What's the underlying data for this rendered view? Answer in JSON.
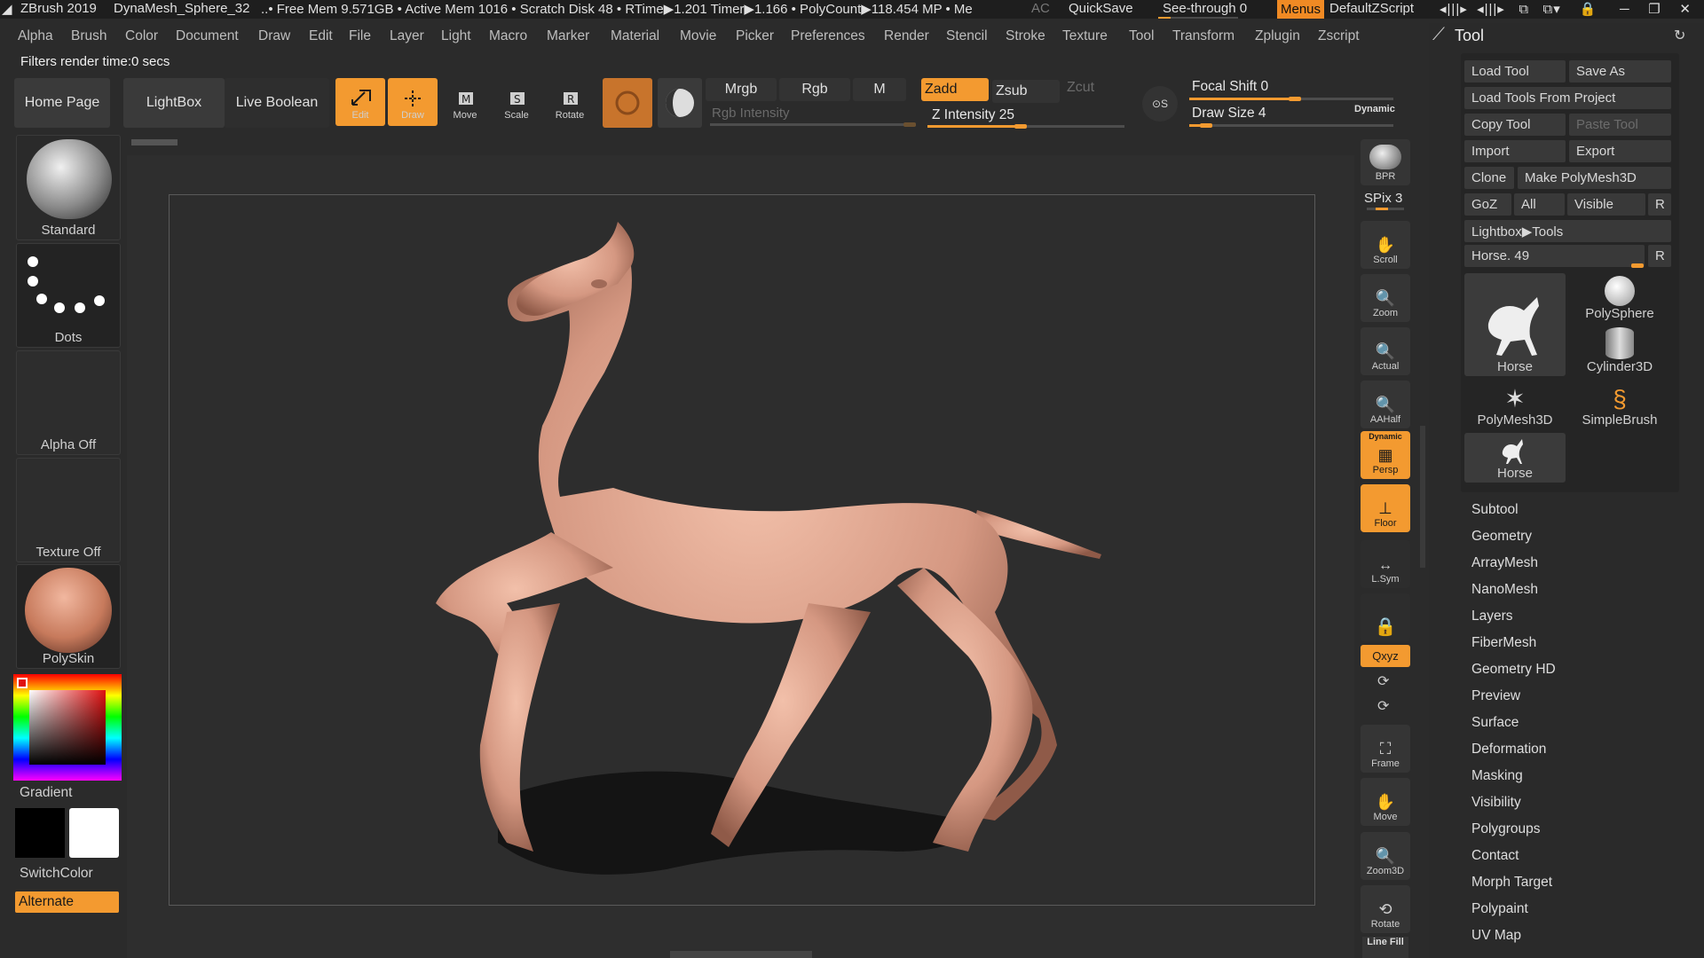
{
  "titlebar": {
    "app": "ZBrush 2019",
    "doc": "DynaMesh_Sphere_32",
    "stats": "..• Free Mem 9.571GB • Active Mem 1016 • Scratch Disk 48 • RTime▶1.201 Timer▶1.166 • PolyCount▶118.454 MP • Me",
    "ac": "AC",
    "quicksave": "QuickSave",
    "see_through": "See-through  0",
    "menus": "Menus",
    "script": "DefaultZScript"
  },
  "menubar": [
    "Alpha",
    "Brush",
    "Color",
    "Document",
    "Draw",
    "Edit",
    "File",
    "Layer",
    "Light",
    "Macro",
    "Marker",
    "Material",
    "Movie",
    "Picker",
    "Preferences",
    "Render",
    "Stencil",
    "Stroke",
    "Texture",
    "Tool",
    "Transform",
    "Zplugin",
    "Zscript"
  ],
  "status": "Filters render time:0 secs",
  "toolbar": {
    "home": "Home Page",
    "lightbox": "LightBox",
    "live_boolean": "Live Boolean",
    "edit": "Edit",
    "draw": "Draw",
    "move": "Move",
    "scale": "Scale",
    "rotate": "Rotate",
    "mrgb": "Mrgb",
    "rgb": "Rgb",
    "m": "M",
    "rgb_intensity": "Rgb Intensity",
    "zadd": "Zadd",
    "zsub": "Zsub",
    "zcut": "Zcut",
    "z_intensity": "Z Intensity 25",
    "focal_shift": "Focal Shift 0",
    "draw_size": "Draw Size 4",
    "dynamic": "Dynamic",
    "z_intensity_value": 25,
    "draw_size_value": 4
  },
  "left_palette": {
    "brush": "Standard",
    "stroke": "Dots",
    "alpha": "Alpha Off",
    "texture": "Texture Off",
    "material": "PolySkin",
    "gradient": "Gradient",
    "switchcolor": "SwitchColor",
    "alternate": "Alternate"
  },
  "right_shelf": {
    "bpr": "BPR",
    "spix": "SPix 3",
    "scroll": "Scroll",
    "zoom": "Zoom",
    "actual": "Actual",
    "aahalf": "AAHalf",
    "persp_top": "Dynamic",
    "persp": "Persp",
    "floor": "Floor",
    "lsym": "L.Sym",
    "xyz": "Qxyz",
    "frame": "Frame",
    "move": "Move",
    "zoom3d": "Zoom3D",
    "rotate": "Rotate",
    "linefill": "Line Fill"
  },
  "tool_panel": {
    "title": "Tool",
    "load_tool": "Load Tool",
    "save_as": "Save As",
    "load_from_project": "Load Tools From Project",
    "copy_tool": "Copy Tool",
    "paste_tool": "Paste Tool",
    "import": "Import",
    "export": "Export",
    "clone": "Clone",
    "make_polymesh": "Make PolyMesh3D",
    "goz": "GoZ",
    "all": "All",
    "visible": "Visible",
    "r": "R",
    "lightbox_tools": "Lightbox▶Tools",
    "current_tool": "Horse. 49",
    "thumbs": [
      "Horse",
      "PolySphere",
      "Cylinder3D",
      "PolyMesh3D",
      "SimpleBrush",
      "Horse"
    ],
    "sections": [
      "Subtool",
      "Geometry",
      "ArrayMesh",
      "NanoMesh",
      "Layers",
      "FiberMesh",
      "Geometry HD",
      "Preview",
      "Surface",
      "Deformation",
      "Masking",
      "Visibility",
      "Polygroups",
      "Contact",
      "Morph Target",
      "Polypaint",
      "UV Map"
    ]
  },
  "colors": {
    "accent": "#f39a30",
    "model_skin": "#d9a08a"
  }
}
